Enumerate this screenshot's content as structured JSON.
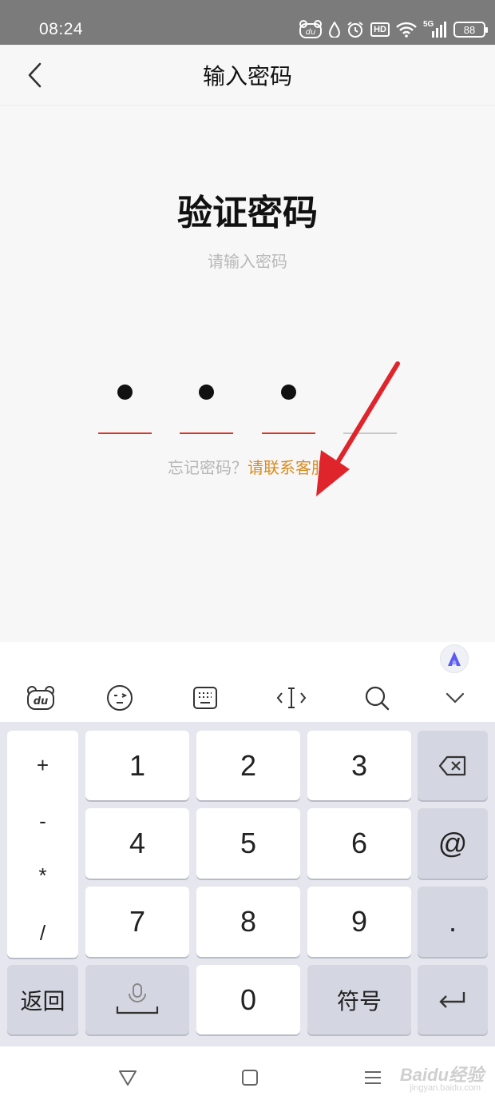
{
  "status_bar": {
    "time": "08:24",
    "network": "5G",
    "battery": "88",
    "hd": "HD",
    "du_badge": "du"
  },
  "nav": {
    "title": "输入密码"
  },
  "main": {
    "title": "验证密码",
    "subtitle": "请输入密码",
    "pin": {
      "length": 4,
      "filled": 3,
      "active_color": "#d9342b",
      "inactive_color": "#c8c8c8"
    },
    "forgot_text": "忘记密码？",
    "forgot_link": "请联系客服"
  },
  "keyboard": {
    "toolbar_icons": [
      "bear-logo-icon",
      "emoji-icon",
      "keyboard-icon",
      "cursor-icon",
      "search-icon",
      "collapse-icon"
    ],
    "symbols": [
      "+",
      "-",
      "*",
      "/"
    ],
    "digits": [
      "1",
      "2",
      "3",
      "4",
      "5",
      "6",
      "7",
      "8",
      "9"
    ],
    "zero": "0",
    "back_label": "返回",
    "symbol_label": "符号",
    "at": "@",
    "dot": ".",
    "du_label": "du"
  },
  "watermark": {
    "text": "Baidu经验",
    "sub": "jingyan.baidu.com"
  }
}
